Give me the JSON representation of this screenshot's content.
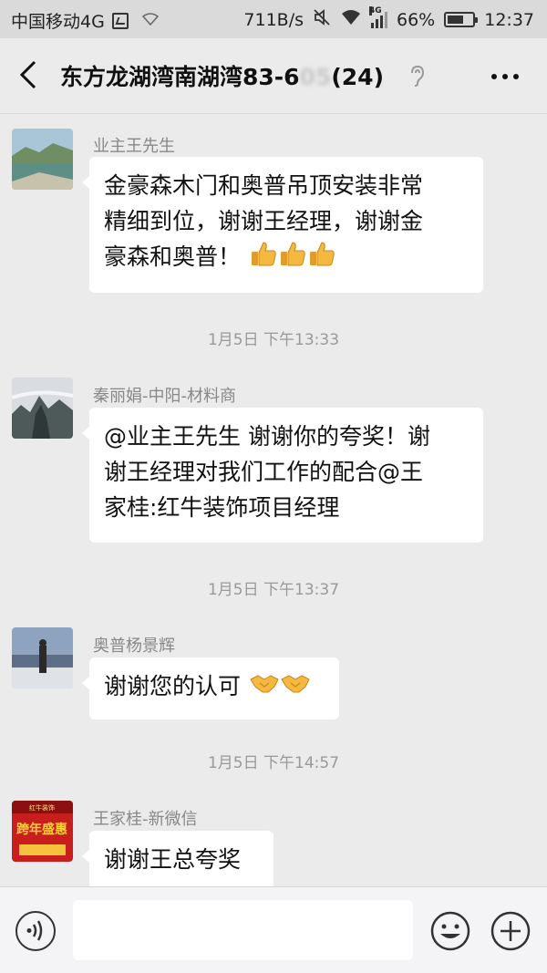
{
  "status_bar": {
    "carrier": "中国移动4G",
    "speed": "711B/s",
    "network_badge": "4G",
    "battery": "66%",
    "battery_level": 0.66,
    "time": "12:37"
  },
  "header": {
    "title": "东方龙湖湾南湖湾83-6",
    "title_hidden": "05",
    "member_count": "(24)"
  },
  "messages": [
    {
      "sender": "业主王先生",
      "lines": [
        "金豪森木门和奥普吊顶安装非常",
        "精细到位，谢谢王经理，谢谢金",
        "豪森和奥普！"
      ],
      "emoji": [
        "thumbs-up-icon",
        "thumbs-up-icon",
        "thumbs-up-icon"
      ]
    },
    {
      "sender": "秦丽娟-中阳-材料商",
      "lines": [
        "@业主王先生 谢谢你的夸奖！谢",
        "谢王经理对我们工作的配合@王",
        "家桂:红牛装饰项目经理"
      ]
    },
    {
      "sender": "奥普杨景辉",
      "lines": [
        "谢谢您的认可"
      ],
      "emoji": [
        "handshake-icon",
        "handshake-icon"
      ]
    },
    {
      "sender": "王家桂-新微信",
      "lines": [
        "谢谢王总夸奖"
      ],
      "avatar_text": {
        "brand": "红牛装饰",
        "headline": "跨年盛惠"
      }
    }
  ],
  "timestamps": [
    "1月5日 下午13:33",
    "1月5日 下午13:37",
    "1月5日 下午14:57"
  ],
  "input": {
    "placeholder": ""
  },
  "colors": {
    "background": "#ebebeb",
    "bubble": "#ffffff",
    "timestamp": "#999999",
    "sender": "#888888",
    "emoji_yellow": "#f5b942"
  }
}
